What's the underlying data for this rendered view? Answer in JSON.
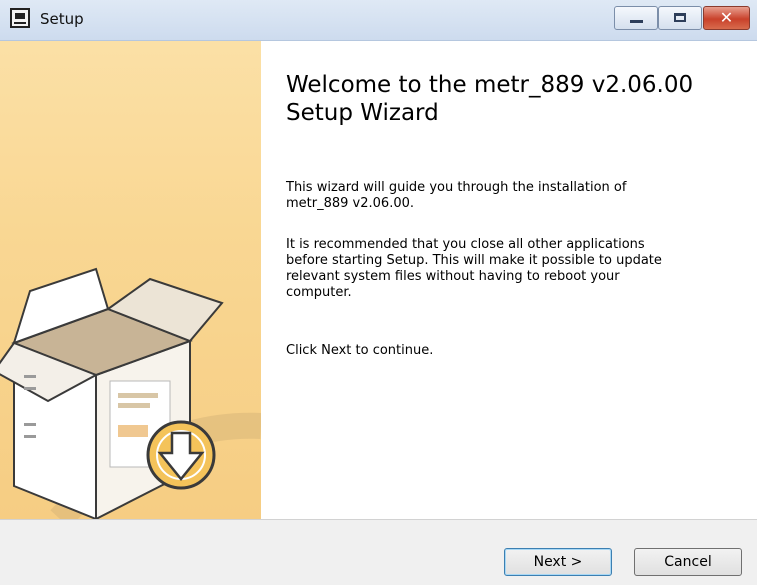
{
  "window": {
    "title": "Setup",
    "icon": "setup-app-icon",
    "controls": {
      "minimize": "minimize-icon",
      "maximize": "maximize-icon",
      "close": "close-icon",
      "close_glyph": "✕"
    }
  },
  "colors": {
    "banner": "#f9d793",
    "close_button": "#c9412b",
    "footer": "#f0f0f0"
  },
  "banner": {
    "illustration": "software-box-download-icon"
  },
  "content": {
    "heading_line1": "Welcome to the metr_889 v2.06.00",
    "heading_line2": "Setup Wizard",
    "paragraph1_line1": "This wizard will guide you through the installation of",
    "paragraph1_line2": "metr_889 v2.06.00.",
    "paragraph2_line1": "It is recommended that you close all other applications",
    "paragraph2_line2": "before starting Setup. This will make it possible to update",
    "paragraph2_line3": "relevant system files without having to reboot your",
    "paragraph2_line4": "computer.",
    "paragraph3": "Click Next to continue."
  },
  "footer": {
    "next_label": "Next >",
    "cancel_label": "Cancel"
  }
}
